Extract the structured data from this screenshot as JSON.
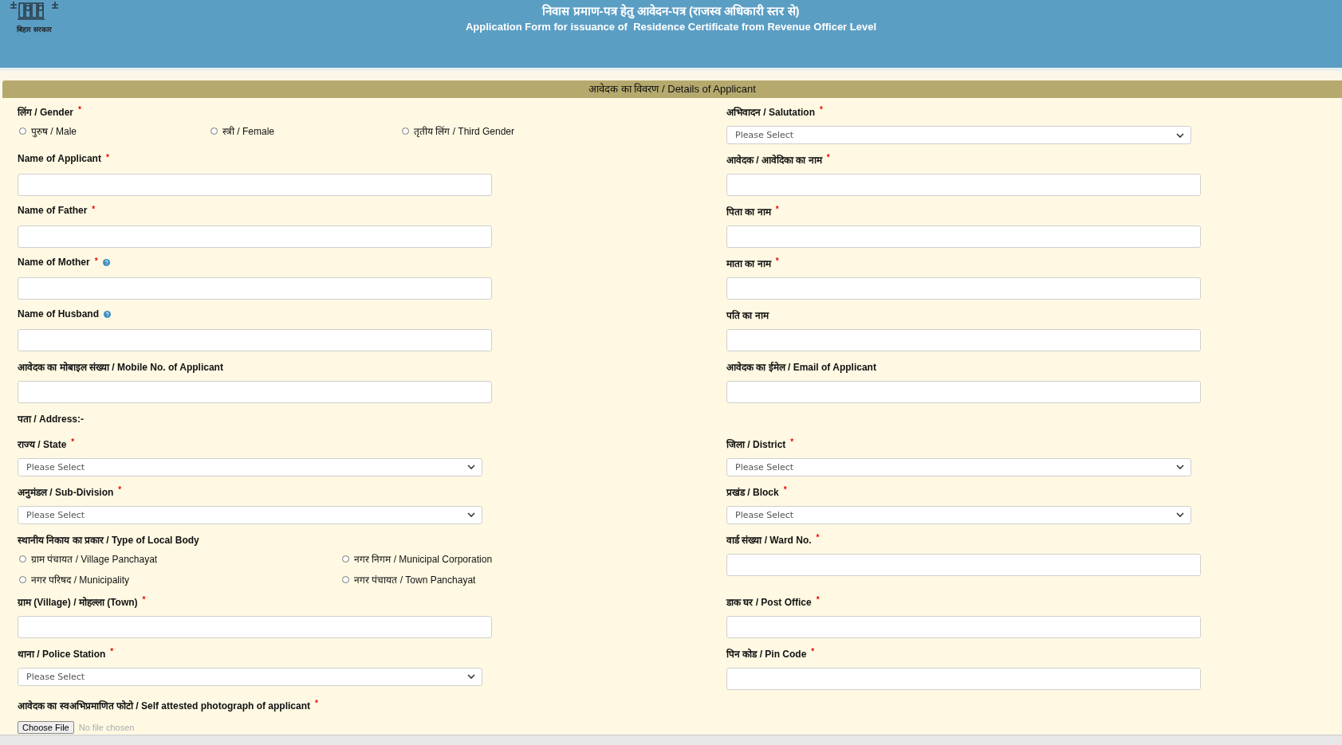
{
  "header": {
    "logo_caption": "बिहार सरकार",
    "title_hindi": "निवास प्रमाण-पत्र हेतु आवेदन-पत्र (राजस्व अधिकारी स्तर से)",
    "title_english": "Application Form for issuance of  Residence Certificate from Revenue Officer Level"
  },
  "section": {
    "title": "आवेदक का विवरण / Details of Applicant"
  },
  "rows": [
    {
      "left": {
        "kind": "radio-row",
        "label": "लिंग / Gender",
        "required_mark": "*",
        "options": [
          {
            "label": "पुरुष / Male",
            "selected": false
          },
          {
            "label": "स्त्री / Female",
            "selected": false
          },
          {
            "label": "तृतीय लिंग / Third Gender",
            "selected": false
          }
        ]
      },
      "right": {
        "kind": "select",
        "label": "अभिवादन / Salutation",
        "required_mark": "*",
        "placeholder": "Please Select"
      }
    },
    {
      "left": {
        "kind": "text",
        "label": "Name of Applicant",
        "required_mark": "*"
      },
      "right": {
        "kind": "text",
        "label": "आवेदक / आवेदिका का नाम",
        "required_mark": "*"
      }
    },
    {
      "left": {
        "kind": "text",
        "label": "Name of Father",
        "required_mark": "*"
      },
      "right": {
        "kind": "text",
        "label": "पिता का नाम",
        "required_mark": "*"
      }
    },
    {
      "left": {
        "kind": "text",
        "label": "Name of Mother",
        "required_mark": "*",
        "help": true
      },
      "right": {
        "kind": "text",
        "label": "माता का नाम",
        "required_mark": "*"
      }
    },
    {
      "left": {
        "kind": "text",
        "label": "Name of Husband",
        "help": true
      },
      "right": {
        "kind": "text",
        "label": "पति का नाम"
      }
    },
    {
      "left": {
        "kind": "text",
        "label": "आवेदक का मोबाइल संख्या / Mobile No. of Applicant"
      },
      "right": {
        "kind": "text",
        "label": "आवेदक का ईमेल / Email of Applicant"
      }
    },
    {
      "left": {
        "kind": "heading",
        "label": "पता / Address:-"
      }
    },
    {
      "left": {
        "kind": "select",
        "label": "राज्य / State",
        "required_mark": "*",
        "placeholder": "Please Select"
      },
      "right": {
        "kind": "select",
        "label": "जिला / District",
        "required_mark": "*",
        "placeholder": "Please Select"
      }
    },
    {
      "left": {
        "kind": "select",
        "label": "अनुमंडल / Sub-Division",
        "required_mark": "*",
        "placeholder": "Please Select"
      },
      "right": {
        "kind": "select",
        "label": "प्रखंड / Block",
        "required_mark": "*",
        "placeholder": "Please Select"
      }
    },
    {
      "left": {
        "kind": "radio-grid",
        "label": "स्थानीय निकाय का प्रकार / Type of Local Body",
        "options": [
          {
            "label": "ग्राम पंचायत / Village Panchayat",
            "selected": false
          },
          {
            "label": "नगर निगम / Municipal Corporation",
            "selected": false
          },
          {
            "label": "नगर परिषद / Municipality",
            "selected": false
          },
          {
            "label": "नगर पंचायत / Town Panchayat",
            "selected": false
          }
        ]
      },
      "right": {
        "kind": "text",
        "label": "वार्ड संख्या / Ward No.",
        "required_mark": "*"
      }
    },
    {
      "left": {
        "kind": "text",
        "label": "ग्राम (Village) / मोहल्ला (Town)",
        "required_mark": "*"
      },
      "right": {
        "kind": "text",
        "label": "डाक घर / Post Office",
        "required_mark": "*"
      }
    },
    {
      "left": {
        "kind": "select",
        "label": "थाना / Police Station",
        "required_mark": "*",
        "placeholder": "Please Select"
      },
      "right": {
        "kind": "text",
        "label": "पिन कोड / Pin Code",
        "required_mark": "*"
      }
    },
    {
      "left": {
        "kind": "file",
        "label": "आवेदक का स्वअभिप्रमाणित फोटो / Self attested photograph of applicant",
        "required_mark": "*",
        "button": "Choose File",
        "status": "No file chosen"
      }
    }
  ]
}
